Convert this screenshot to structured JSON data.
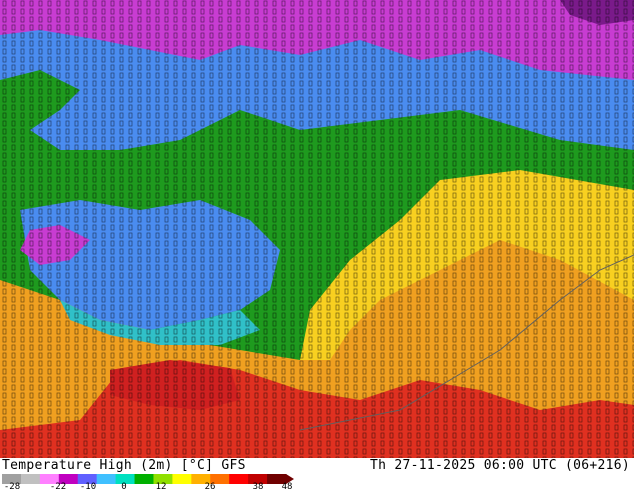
{
  "map": {
    "title_left": "Temperature High (2m) [°C] GFS",
    "title_right": "Th 27-11-2025 06:00 UTC (06+216)"
  },
  "legend": {
    "ticks": [
      "-28",
      "-22",
      "-10",
      "0",
      "12",
      "26",
      "38",
      "48"
    ],
    "colors": [
      "#a0a0a0",
      "#c0c0c0",
      "#ff80ff",
      "#c000c0",
      "#6060ff",
      "#40c0ff",
      "#00e0c0",
      "#00b000",
      "#90e000",
      "#ffff00",
      "#ffb000",
      "#ff7000",
      "#ff0000",
      "#c00000",
      "#700000"
    ]
  },
  "regions": [
    {
      "name": "north-cold",
      "color": "#c83cd2"
    },
    {
      "name": "cold-belt",
      "color": "#4a8cf0"
    },
    {
      "name": "mild-belt",
      "color": "#1e9a1e"
    },
    {
      "name": "warm-belt",
      "color": "#f0a020"
    },
    {
      "name": "hot-belt",
      "color": "#e03020"
    }
  ]
}
